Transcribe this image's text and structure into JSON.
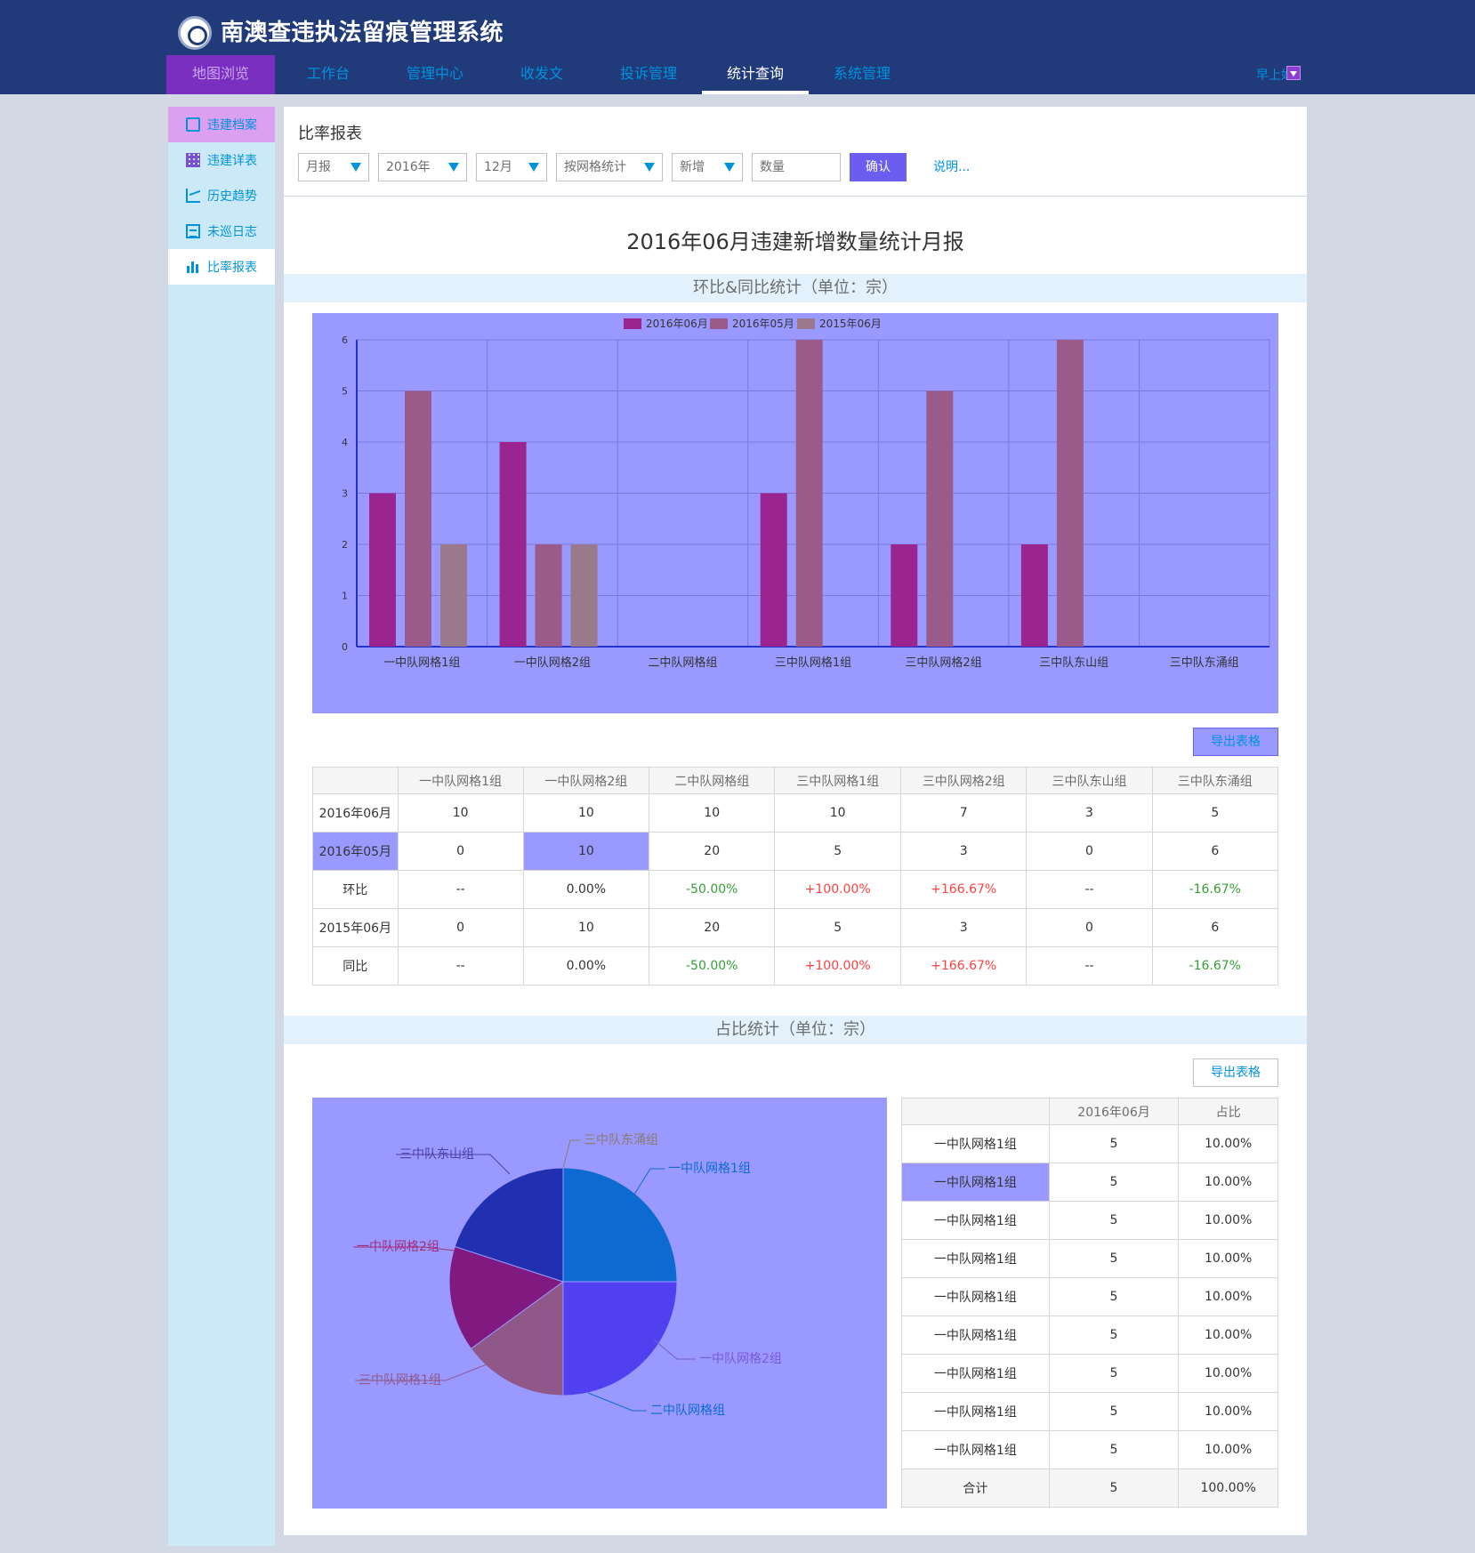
{
  "app": {
    "title": "南澳查违执法留痕管理系统",
    "nav": [
      "地图浏览",
      "工作台",
      "管理中心",
      "收发文",
      "投诉管理",
      "统计查询",
      "系统管理"
    ],
    "active_nav": 5,
    "user_greeting": "早上好，"
  },
  "sidebar": {
    "items": [
      {
        "label": "违建档案",
        "icon": "document-icon"
      },
      {
        "label": "违建详表",
        "icon": "grid-table-icon"
      },
      {
        "label": "历史趋势",
        "icon": "trend-chart-icon"
      },
      {
        "label": "未巡日志",
        "icon": "log-icon"
      },
      {
        "label": "比率报表",
        "icon": "bar-chart-icon"
      }
    ],
    "active_index": 4
  },
  "page": {
    "heading": "比率报表",
    "filters": {
      "report_type": "月报",
      "year": "2016年",
      "month": "12月",
      "stat_by": "按网格统计",
      "category": "新增",
      "metric": "数量",
      "confirm": "确认",
      "help": "说明..."
    },
    "report_title": "2016年06月违建新增数量统计月报",
    "section1_title": "环比&同比统计（单位：宗）",
    "section2_title": "占比统计（单位：宗）",
    "export_label": "导出表格"
  },
  "colors": {
    "header_bg": "#213a7a",
    "accent": "#0093dd",
    "page_bg": "#d2d8e4",
    "sidebar_bg": "#cce9f7",
    "positive": "#ff4141",
    "negative": "#33a033"
  },
  "chart_data": {
    "type": "bar",
    "categories": [
      "一中队网格1组",
      "一中队网格2组",
      "二中队网格组",
      "三中队网格1组",
      "三中队网格2组",
      "三中队东山组",
      "三中队东涌组"
    ],
    "series": [
      {
        "name": "2016年06月",
        "color": "#9b2590",
        "values": [
          3,
          4,
          0,
          3,
          2,
          2,
          0
        ]
      },
      {
        "name": "2016年05月",
        "color": "#9a5a8a",
        "values": [
          5,
          2,
          0,
          6,
          5,
          6,
          0
        ]
      },
      {
        "name": "2015年06月",
        "color": "#9a7a8a",
        "values": [
          2,
          2,
          0,
          0,
          0,
          0,
          0
        ]
      }
    ],
    "ylim": [
      0,
      6
    ],
    "yticks": [
      0,
      1,
      2,
      3,
      4,
      5,
      6
    ],
    "legend": "top-center",
    "grid": true
  },
  "comparison_table": {
    "columns": [
      "",
      "一中队网格1组",
      "一中队网格2组",
      "二中队网格组",
      "三中队网格1组",
      "三中队网格2组",
      "三中队东山组",
      "三中队东涌组"
    ],
    "rows": [
      {
        "label": "2016年06月",
        "cells": [
          "10",
          "10",
          "10",
          "10",
          "7",
          "3",
          "5"
        ]
      },
      {
        "label": "2016年05月",
        "cells": [
          "0",
          "10",
          "20",
          "5",
          "3",
          "0",
          "6"
        ]
      },
      {
        "label": "环比",
        "cells": [
          "--",
          "0.00%",
          "-50.00%",
          "+100.00%",
          "+166.67%",
          "--",
          "-16.67%"
        ]
      },
      {
        "label": "2015年06月",
        "cells": [
          "0",
          "10",
          "20",
          "5",
          "3",
          "0",
          "6"
        ]
      },
      {
        "label": "同比",
        "cells": [
          "--",
          "0.00%",
          "-50.00%",
          "+100.00%",
          "+166.67%",
          "--",
          "-16.67%"
        ]
      }
    ]
  },
  "pie_data": {
    "type": "pie",
    "slices": [
      {
        "label": "一中队网格1组",
        "value": 25,
        "color": "#0d6ad0"
      },
      {
        "label": "一中队网格2组",
        "value": 25,
        "color": "#5040f0"
      },
      {
        "label": "二中队网格组",
        "value": 0,
        "color": "#3090e0"
      },
      {
        "label": "三中队网格1组",
        "value": 15,
        "color": "#905888"
      },
      {
        "label": "一中队网格2组",
        "value": 15,
        "color": "#801a80"
      },
      {
        "label": "三中队东山组",
        "value": 20,
        "color": "#2030b0"
      },
      {
        "label": "三中队东涌组",
        "value": 0,
        "color": "#8a8a8a"
      }
    ],
    "outer_labels": [
      {
        "text": "一中队网格1组",
        "color": "#0d6ad0"
      },
      {
        "text": "一中队网格2组",
        "color": "#7a5ad0"
      },
      {
        "text": "二中队网格组",
        "color": "#0d6ad0"
      },
      {
        "text": "三中队网格1组",
        "color": "#905888"
      },
      {
        "text": "一中队网格2组",
        "color": "#a0307a"
      },
      {
        "text": "三中队东山组",
        "color": "#5040a0"
      },
      {
        "text": "三中队东涌组",
        "color": "#8a7a70"
      }
    ]
  },
  "share_table": {
    "columns": [
      "",
      "2016年06月",
      "占比"
    ],
    "rows": [
      [
        "一中队网格1组",
        "5",
        "10.00%"
      ],
      [
        "一中队网格1组",
        "5",
        "10.00%"
      ],
      [
        "一中队网格1组",
        "5",
        "10.00%"
      ],
      [
        "一中队网格1组",
        "5",
        "10.00%"
      ],
      [
        "一中队网格1组",
        "5",
        "10.00%"
      ],
      [
        "一中队网格1组",
        "5",
        "10.00%"
      ],
      [
        "一中队网格1组",
        "5",
        "10.00%"
      ],
      [
        "一中队网格1组",
        "5",
        "10.00%"
      ],
      [
        "一中队网格1组",
        "5",
        "10.00%"
      ]
    ],
    "total": [
      "合计",
      "5",
      "100.00%"
    ]
  }
}
